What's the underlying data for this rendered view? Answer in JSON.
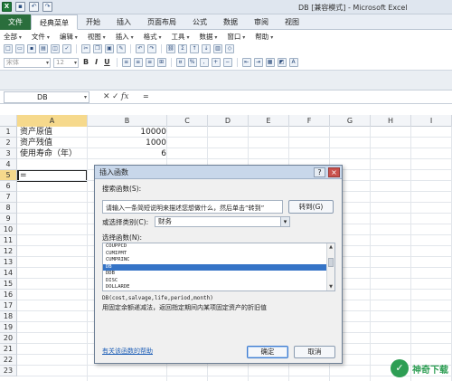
{
  "window": {
    "title": "DB  [兼容模式] - Microsoft Excel"
  },
  "ribbon_tabs": [
    "文件",
    "经典菜单",
    "开始",
    "插入",
    "页面布局",
    "公式",
    "数据",
    "审阅",
    "视图"
  ],
  "menus": [
    "全部",
    "文件",
    "编辑",
    "视图",
    "插入",
    "格式",
    "工具",
    "数据",
    "窗口",
    "帮助"
  ],
  "toolbar": {
    "font_name": "宋体",
    "font_size": "12",
    "bold": "B",
    "italic": "I",
    "underline": "U"
  },
  "formula_bar": {
    "name_box": "DB",
    "cancel_icon": "x-icon",
    "enter_icon": "check-icon",
    "fx_label": "fx",
    "value": "="
  },
  "columns": [
    "A",
    "B",
    "C",
    "D",
    "E",
    "F",
    "G",
    "H",
    "I"
  ],
  "rows": [
    "1",
    "2",
    "3",
    "4",
    "5",
    "6",
    "7",
    "8",
    "9",
    "10",
    "11",
    "12",
    "13",
    "14",
    "15",
    "16",
    "17",
    "18",
    "19",
    "20",
    "21",
    "22",
    "23"
  ],
  "cells": {
    "a1": "资产原值",
    "b1": "10000",
    "a2": "资产残值",
    "b2": "1000",
    "a3": "使用寿命（年）",
    "b3": "6",
    "a5": "="
  },
  "dialog": {
    "title": "插入函数",
    "help_icon": "?",
    "close_icon": "×",
    "search_label": "搜索函数(S):",
    "search_text": "请输入一条简短说明来描述您想做什么，然后单击“转到”",
    "goto_label": "转到(G)",
    "category_label": "或选择类别(C):",
    "category_value": "财务",
    "select_label": "选择函数(N):",
    "functions": [
      "COUPPCD",
      "CUMIPMT",
      "CUMPRINC",
      "DB",
      "DDB",
      "DISC",
      "DOLLARDE"
    ],
    "selected_function": "DB",
    "signature": "DB(cost,salvage,life,period,month)",
    "description": "用固定余额递减法，返回指定期间内某项固定资产的折旧值",
    "help_link": "有关该函数的帮助",
    "ok_label": "确定",
    "cancel_label": "取消"
  },
  "watermark": {
    "logo_char": "✓",
    "text": "神奇下载"
  },
  "colors": {
    "file_tab": "#2a6e3c",
    "selection_header": "#f6d98c",
    "list_selected": "#3574c7",
    "link": "#1f5fb7",
    "watermark": "#2e9e54"
  }
}
